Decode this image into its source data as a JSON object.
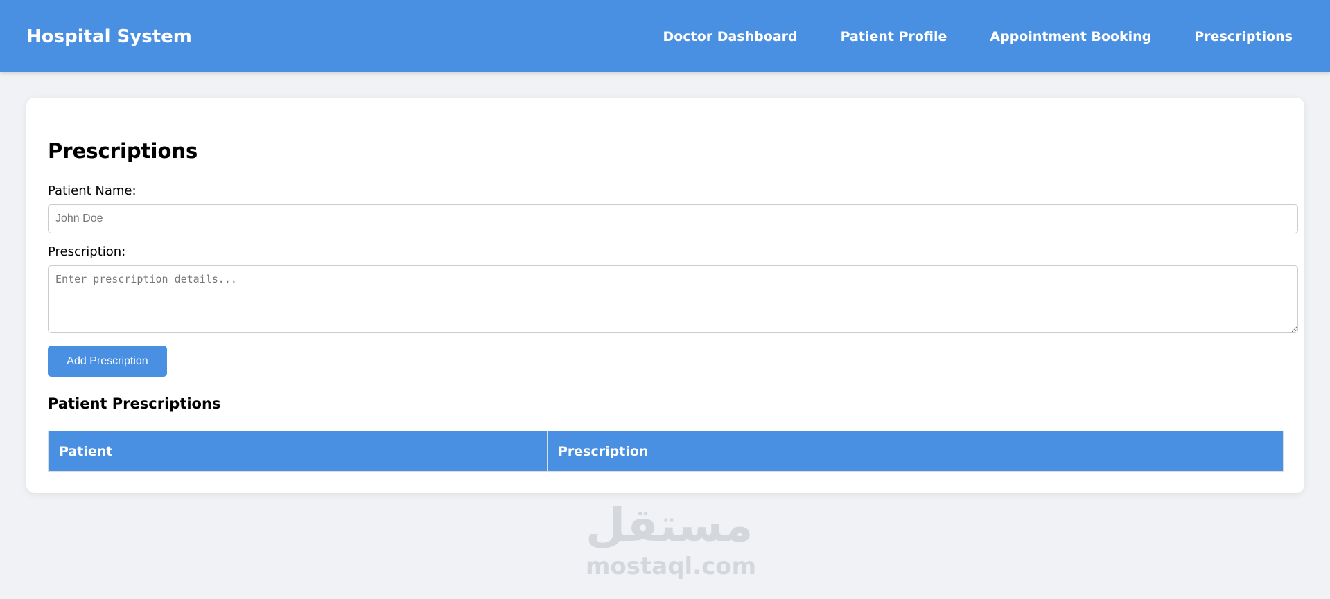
{
  "navbar": {
    "brand": "Hospital System",
    "links": [
      {
        "label": "Doctor Dashboard"
      },
      {
        "label": "Patient Profile"
      },
      {
        "label": "Appointment Booking"
      },
      {
        "label": "Prescriptions"
      }
    ]
  },
  "main": {
    "title": "Prescriptions",
    "patient_label": "Patient Name:",
    "patient_placeholder": "John Doe",
    "prescription_label": "Prescription:",
    "prescription_placeholder": "Enter prescription details...",
    "add_button": "Add Prescription",
    "section_title": "Patient Prescriptions",
    "table": {
      "headers": [
        "Patient",
        "Prescription"
      ],
      "rows": []
    }
  },
  "watermark": {
    "arabic": "مستقل",
    "latin": "mostaql.com"
  },
  "colors": {
    "accent": "#4a90e2",
    "background": "#f0f2f5",
    "card": "#ffffff"
  }
}
